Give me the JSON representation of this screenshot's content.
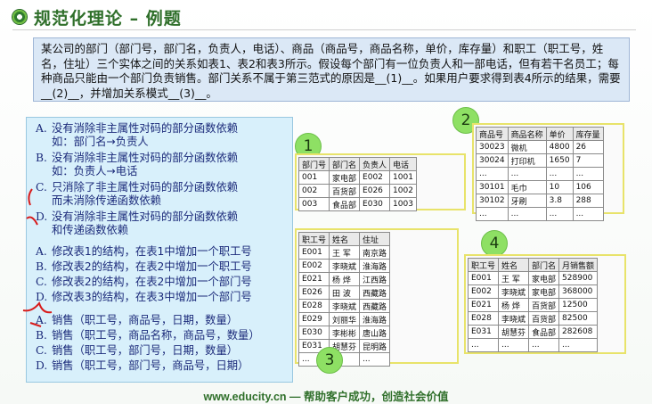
{
  "title": "规范化理论 – 例题",
  "question": "某公司的部门（部门号，部门名，负责人，电话）、商品（商品号，商品名称，单价，库存量）和职工（职工号，姓名，住址）三个实体之间的关系如表1、表2和表3所示。假设每个部门有一位负责人和一部电话，但有若干名员工；每种商品只能由一个部门负责销售。部门关系不属于第三范式的原因是__(1)__。如果用户要求得到表4所示的结果，需要__(2)__，并增加关系模式__(3)__。",
  "options_q1": [
    {
      "key": "A.",
      "line1": "没有消除非主属性对码的部分函数依赖",
      "line2": "如：部门名→负责人"
    },
    {
      "key": "B.",
      "line1": "没有消除非主属性对码的部分函数依赖",
      "line2": "如：负责人→电话"
    },
    {
      "key": "C.",
      "line1": "只消除了非主属性对码的部分函数依赖",
      "line2": "而未消除传递函数依赖"
    },
    {
      "key": "D.",
      "line1": "没有消除非主属性对码的部分函数依赖",
      "line2": "和传递函数依赖"
    }
  ],
  "options_q2": [
    {
      "key": "A.",
      "text": "修改表1的结构，在表1中增加一个职工号"
    },
    {
      "key": "B.",
      "text": "修改表2的结构，在表2中增加一个职工号"
    },
    {
      "key": "C.",
      "text": "修改表2的结构，在表2中增加一个部门号"
    },
    {
      "key": "D.",
      "text": "修改表3的结构，在表3中增加一个部门号"
    }
  ],
  "options_q3": [
    {
      "key": "A.",
      "text": "销售（职工号，商品号，日期，数量）"
    },
    {
      "key": "B.",
      "text": "销售（职工号，商品名称，商品号，数量）"
    },
    {
      "key": "C.",
      "text": "销售（职工号，部门号，日期，数量）"
    },
    {
      "key": "D.",
      "text": "销售（职工号，部门号，商品号，日期）"
    }
  ],
  "table1": {
    "badge": "1",
    "headers": [
      "部门号",
      "部门名",
      "负责人",
      "电话"
    ],
    "rows": [
      [
        "001",
        "家电部",
        "E002",
        "1001"
      ],
      [
        "002",
        "百货部",
        "E026",
        "1002"
      ],
      [
        "003",
        "食品部",
        "E030",
        "1003"
      ]
    ]
  },
  "table2": {
    "badge": "2",
    "headers": [
      "商品号",
      "商品名称",
      "单价",
      "库存量"
    ],
    "rows": [
      [
        "30023",
        "微机",
        "4800",
        "26"
      ],
      [
        "30024",
        "打印机",
        "1650",
        "7"
      ],
      [
        "...",
        "...",
        "...",
        "..."
      ],
      [
        "30101",
        "毛巾",
        "10",
        "106"
      ],
      [
        "30102",
        "牙刷",
        "3.8",
        "288"
      ],
      [
        "...",
        "...",
        "...",
        "..."
      ]
    ]
  },
  "table3": {
    "badge": "3",
    "headers": [
      "职工号",
      "姓名",
      "住址"
    ],
    "rows": [
      [
        "E001",
        "王 军",
        "南京路"
      ],
      [
        "E002",
        "李晓斌",
        "淮海路"
      ],
      [
        "E021",
        "杨 烨",
        "江西路"
      ],
      [
        "E026",
        "田 波",
        "西藏路"
      ],
      [
        "E028",
        "李晓斌",
        "西藏路"
      ],
      [
        "E029",
        "刘丽华",
        "淮海路"
      ],
      [
        "E030",
        "李彬彬",
        "唐山路"
      ],
      [
        "E031",
        "胡慧芬",
        "昆明路"
      ],
      [
        "...",
        "...",
        "..."
      ]
    ]
  },
  "table4": {
    "badge": "4",
    "headers": [
      "职工号",
      "姓名",
      "部门名",
      "月销售额"
    ],
    "rows": [
      [
        "E001",
        "王 军",
        "家电部",
        "528900"
      ],
      [
        "E002",
        "李晓斌",
        "家电部",
        "368000"
      ],
      [
        "E021",
        "杨 烨",
        "百货部",
        "12500"
      ],
      [
        "E028",
        "李晓斌",
        "百货部",
        "82500"
      ],
      [
        "E031",
        "胡慧芬",
        "食品部",
        "282608"
      ],
      [
        "...",
        "...",
        "...",
        "..."
      ]
    ]
  },
  "footer": "www.educity.cn — 帮助客户成功，创造社会价值",
  "colors": {
    "title": "#2f6f2a",
    "question_bg": "#dbe8f6",
    "options_bg": "#d8f0fb",
    "option_text": "#1b2a7a",
    "badge": "#8ee064",
    "table_border": "#e8e36a",
    "pen_red": "#d81b1b"
  }
}
